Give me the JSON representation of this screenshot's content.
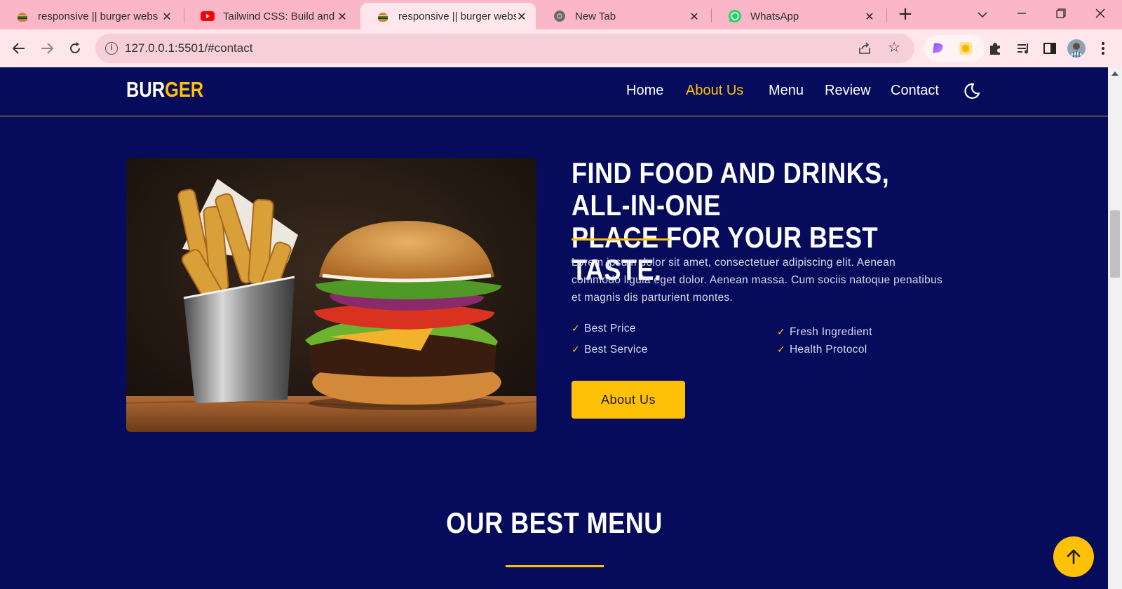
{
  "browser": {
    "tabs": [
      {
        "title": "responsive || burger webs",
        "icon": "burger-favicon-icon",
        "active": false
      },
      {
        "title": "Tailwind CSS: Build and De",
        "icon": "youtube-icon",
        "active": false
      },
      {
        "title": "responsive || burger webs",
        "icon": "burger-favicon-icon",
        "active": true
      },
      {
        "title": "New Tab",
        "icon": "chrome-icon",
        "active": false
      },
      {
        "title": "WhatsApp",
        "icon": "whatsapp-icon",
        "active": false
      }
    ],
    "tab_close": "✕",
    "new_tab": "+",
    "address": "127.0.0.1:5501/#contact",
    "colors": {
      "tabbar": "#fbb7c7",
      "toolbar": "#ffe6ec"
    }
  },
  "site": {
    "logo_part1": "BUR",
    "logo_part2": "GER",
    "nav": [
      {
        "label": "Home",
        "active": false
      },
      {
        "label": "About Us",
        "active": true
      },
      {
        "label": "Menu",
        "active": false
      },
      {
        "label": "Review",
        "active": false
      },
      {
        "label": "Contact",
        "active": false
      }
    ],
    "colors": {
      "background": "#060b5c",
      "accent": "#ffc107"
    }
  },
  "about": {
    "headline_line1": "FIND FOOD AND DRINKS, ALL-IN-ONE",
    "headline_line2": "PLACE FOR YOUR BEST TASTE.",
    "paragraph_line1": "Lorem ipsum dolor sit amet, consectetuer adipiscing elit. Aenean",
    "paragraph_line2": "commodo ligula eget dolor. Aenean massa. Cum sociis natoque penatibus",
    "paragraph_line3": "et magnis dis parturient montes.",
    "features": [
      "Best Price",
      "Fresh Ingredient",
      "Best Service",
      "Health Protocol"
    ],
    "button_label": "About Us",
    "check_icon": "✓"
  },
  "menu_section": {
    "title": "OUR BEST MENU"
  },
  "scroll_top_icon": "arrow-up-icon"
}
